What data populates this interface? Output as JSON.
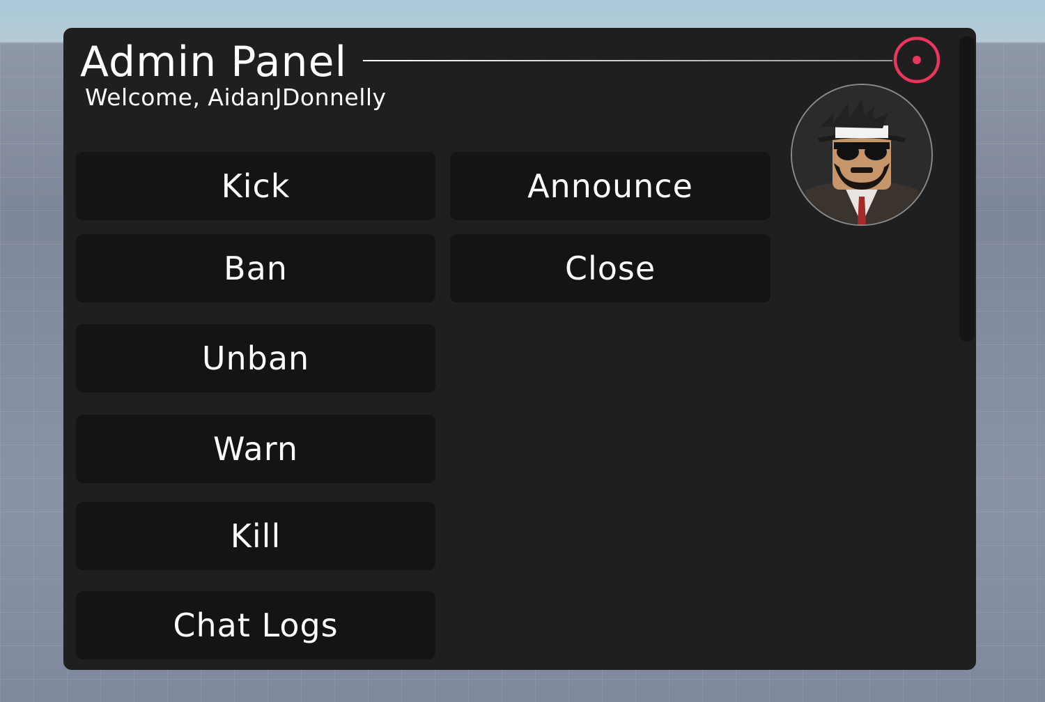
{
  "panel": {
    "title": "Admin Panel",
    "welcome": "Welcome, AidanJDonnelly",
    "accent_color": "#e8365d"
  },
  "buttons": {
    "kick": "Kick",
    "ban": "Ban",
    "unban": "Unban",
    "warn": "Warn",
    "kill": "Kill",
    "chat_logs": "Chat Logs",
    "announce": "Announce",
    "close": "Close"
  },
  "icons": {
    "target": "target-icon",
    "avatar": "user-avatar"
  }
}
